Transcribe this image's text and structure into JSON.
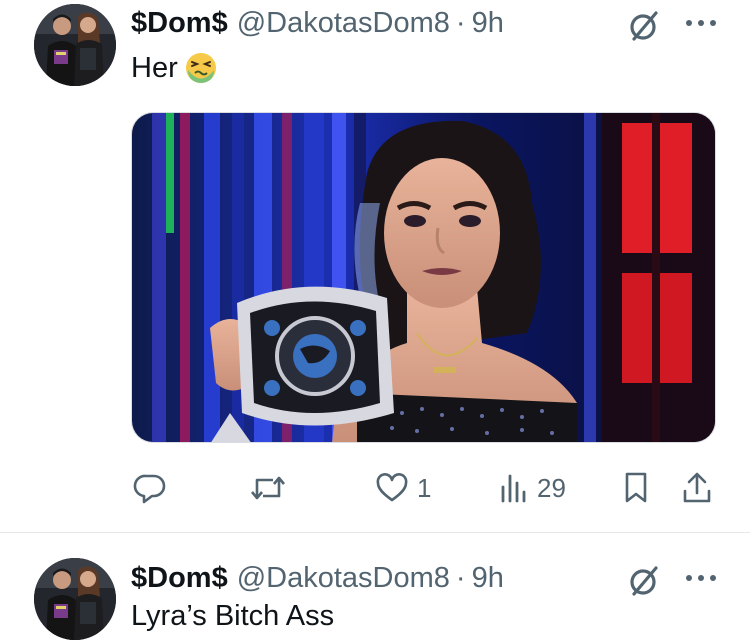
{
  "tweets": [
    {
      "name": "$Dom$",
      "handle": "@DakotasDom8",
      "separator": "·",
      "time": "9h",
      "text": "Her",
      "emoji": "nauseated-face",
      "actions": {
        "replies": "",
        "retweets": "",
        "likes": "1",
        "views": "29"
      }
    },
    {
      "name": "$Dom$",
      "handle": "@DakotasDom8",
      "separator": "·",
      "time": "9h",
      "text": "Lyra’s Bitch Ass"
    }
  ],
  "icons": {
    "grok": "grok-icon",
    "more": "more-icon",
    "reply": "reply-icon",
    "retweet": "retweet-icon",
    "like": "heart-icon",
    "views": "views-icon",
    "bookmark": "bookmark-icon",
    "share": "share-icon"
  },
  "colors": {
    "text": "#0f1419",
    "secondary": "#536471",
    "divider": "#e6e9ec"
  }
}
